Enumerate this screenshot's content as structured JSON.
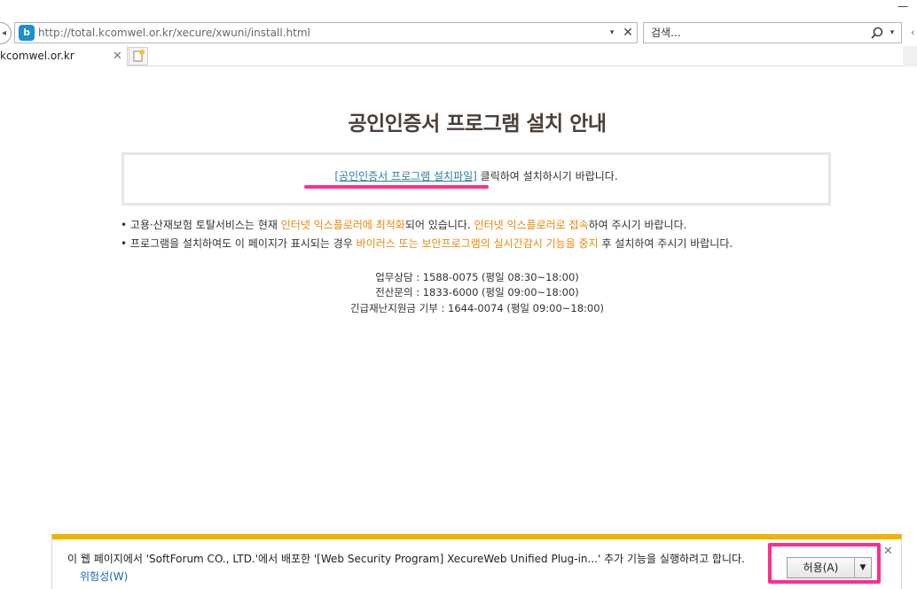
{
  "browser": {
    "url": "http://total.kcomwel.or.kr/xecure/xwuni/install.html",
    "search_placeholder": "검색...",
    "tab_title": "kcomwel.or.kr",
    "site_icon_glyph": "b",
    "minimize_glyph": "—",
    "dropdown_glyph": "▾",
    "close_glyph": "✕"
  },
  "page": {
    "title": "공인인증서 프로그램 설치 안내",
    "install_link_text": "[공인인증서 프로그램 설치파일]",
    "install_suffix": " 클릭하여 설치하시기 바랍니다.",
    "notes": [
      {
        "bullet": "• ",
        "p1": "고용·산재보험 토탈서비스는 현재 ",
        "h1": "인터넷 익스플로러에 최적화",
        "p2": "되어 있습니다. ",
        "h2": "인터넷 익스플로러로 접속",
        "p3": "하여 주시기 바랍니다."
      },
      {
        "bullet": "• ",
        "p1": "프로그램을 설치하여도 이 페이지가 표시되는 경우 ",
        "h1": "바이러스 또는 보안프로그램의 실시간감시 기능을 중지",
        "p2": " 후 설치하여 주시기 바랍니다."
      }
    ],
    "contacts": [
      "업무상담 : 1588-0075 (평일 08:30~18:00)",
      "전산문의 : 1833-6000 (평일 09:00~18:00)",
      "긴급재난지원금 기부 : 1644-0074 (평일 09:00~18:00)"
    ]
  },
  "notification": {
    "message": "이 웹 페이지에서 'SoftForum CO., LTD.'에서 배포한 '[Web Security Program] XecureWeb Unified Plug-in...' 추가 기능을 실행하려고 합니다.",
    "risk_link": "위험성(W)",
    "allow_label": "허용(A)",
    "allow_arrow": "▼",
    "close_glyph": "✕"
  },
  "colors": {
    "highlight_pink": "#ff2d8d",
    "notice_orange": "#e8890c",
    "notify_bar_accent": "#f0b400",
    "link_teal": "#2a7fa0"
  }
}
